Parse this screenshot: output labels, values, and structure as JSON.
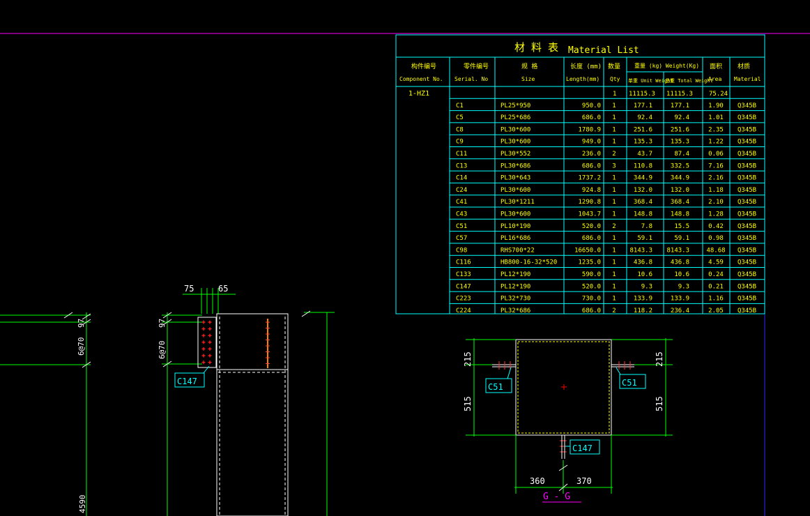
{
  "material_table": {
    "title_cn": "材 料 表",
    "title_en": "Material List",
    "headers": [
      {
        "cn": "构件编号",
        "en": "Component    No."
      },
      {
        "cn": "零件编号",
        "en": "Serial.    No"
      },
      {
        "cn": "规  格",
        "en": "Size"
      },
      {
        "cn": "长度  (mm)",
        "en": "Length(mm)"
      },
      {
        "cn": "数量",
        "en": "Qty"
      },
      {
        "cn": "重量 (kg)  Weight(Kg)",
        "en": ""
      },
      {
        "cn": "面积",
        "en": "Area"
      },
      {
        "cn": "材质",
        "en": "Material"
      }
    ],
    "weight_sub": {
      "unit": "单重  Unit Weight",
      "total": "总重  Total Weight"
    },
    "summary": {
      "component": "1-HZ1",
      "qty": "1",
      "unit_weight": "11115.3",
      "total_weight": "11115.3",
      "area": "75.24"
    },
    "rows": [
      {
        "serial": "C1",
        "size": "PL25*950",
        "length": "950.0",
        "qty": "1",
        "unit": "177.1",
        "total": "177.1",
        "area": "1.90",
        "material": "Q345B"
      },
      {
        "serial": "C5",
        "size": "PL25*686",
        "length": "686.0",
        "qty": "1",
        "unit": "92.4",
        "total": "92.4",
        "area": "1.01",
        "material": "Q345B"
      },
      {
        "serial": "C8",
        "size": "PL30*600",
        "length": "1780.9",
        "qty": "1",
        "unit": "251.6",
        "total": "251.6",
        "area": "2.35",
        "material": "Q345B"
      },
      {
        "serial": "C9",
        "size": "PL30*600",
        "length": "949.0",
        "qty": "1",
        "unit": "135.3",
        "total": "135.3",
        "area": "1.22",
        "material": "Q345B"
      },
      {
        "serial": "C11",
        "size": "PL30*552",
        "length": "236.0",
        "qty": "2",
        "unit": "43.7",
        "total": "87.4",
        "area": "0.06",
        "material": "Q345B"
      },
      {
        "serial": "C13",
        "size": "PL30*686",
        "length": "686.0",
        "qty": "3",
        "unit": "110.8",
        "total": "332.5",
        "area": "7.16",
        "material": "Q345B"
      },
      {
        "serial": "C14",
        "size": "PL30*643",
        "length": "1737.2",
        "qty": "1",
        "unit": "344.9",
        "total": "344.9",
        "area": "2.16",
        "material": "Q345B"
      },
      {
        "serial": "C24",
        "size": "PL30*600",
        "length": "924.8",
        "qty": "1",
        "unit": "132.0",
        "total": "132.0",
        "area": "1.18",
        "material": "Q345B"
      },
      {
        "serial": "C41",
        "size": "PL30*1211",
        "length": "1290.8",
        "qty": "1",
        "unit": "368.4",
        "total": "368.4",
        "area": "2.10",
        "material": "Q345B"
      },
      {
        "serial": "C43",
        "size": "PL30*600",
        "length": "1043.7",
        "qty": "1",
        "unit": "148.8",
        "total": "148.8",
        "area": "1.28",
        "material": "Q345B"
      },
      {
        "serial": "C51",
        "size": "PL10*190",
        "length": "520.0",
        "qty": "2",
        "unit": "7.8",
        "total": "15.5",
        "area": "0.42",
        "material": "Q345B"
      },
      {
        "serial": "C57",
        "size": "PL16*686",
        "length": "686.0",
        "qty": "1",
        "unit": "59.1",
        "total": "59.1",
        "area": "0.98",
        "material": "Q345B"
      },
      {
        "serial": "C98",
        "size": "RHS700*22",
        "length": "16650.0",
        "qty": "1",
        "unit": "8143.3",
        "total": "8143.3",
        "area": "48.68",
        "material": "Q345B"
      },
      {
        "serial": "C116",
        "size": "HB800-16-32*520",
        "length": "1235.0",
        "qty": "1",
        "unit": "436.8",
        "total": "436.8",
        "area": "4.59",
        "material": "Q345B"
      },
      {
        "serial": "C133",
        "size": "PL12*190",
        "length": "590.0",
        "qty": "1",
        "unit": "10.6",
        "total": "10.6",
        "area": "0.24",
        "material": "Q345B"
      },
      {
        "serial": "C147",
        "size": "PL12*190",
        "length": "520.0",
        "qty": "1",
        "unit": "9.3",
        "total": "9.3",
        "area": "0.21",
        "material": "Q345B"
      },
      {
        "serial": "C223",
        "size": "PL32*730",
        "length": "730.0",
        "qty": "1",
        "unit": "133.9",
        "total": "133.9",
        "area": "1.16",
        "material": "Q345B"
      },
      {
        "serial": "C224",
        "size": "PL32*686",
        "length": "686.0",
        "qty": "2",
        "unit": "118.2",
        "total": "236.4",
        "area": "2.05",
        "material": "Q345B"
      }
    ]
  },
  "left_view": {
    "dim_far_left": "4590",
    "dim_left_spacing": "6@70",
    "dim_left_97": "97",
    "dim_top_75": "75",
    "dim_top_65": "65",
    "dim_plate_97": "97",
    "dim_plate_spacing": "6@70",
    "tag_c147": "C147"
  },
  "section_gg": {
    "title": "G - G",
    "dim_left_215": "215",
    "dim_left_515": "515",
    "dim_right_215": "215",
    "dim_right_515": "515",
    "dim_bottom_360": "360",
    "dim_bottom_370": "370",
    "tag_c51_left": "C51",
    "tag_c51_right": "C51",
    "tag_c147": "C147"
  },
  "colors": {
    "background": "#000000",
    "cyan": "#00ffff",
    "yellow": "#ffff00",
    "green": "#00ff00",
    "white": "#ffffff",
    "magenta": "#ff00ff",
    "red": "#ff0000",
    "orange": "#ff8000",
    "blue": "#0000ff"
  }
}
